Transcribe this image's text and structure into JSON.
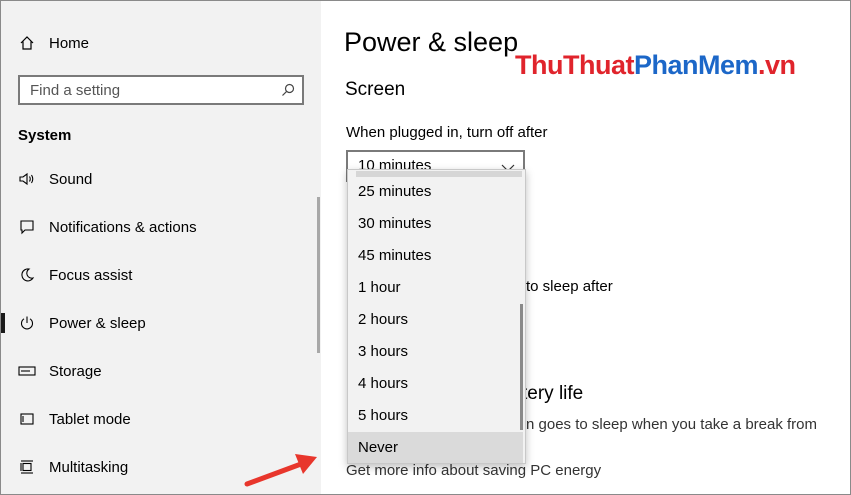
{
  "sidebar": {
    "home_label": "Home",
    "search_placeholder": "Find a setting",
    "section_title": "System",
    "items": [
      {
        "label": "Sound",
        "icon": "speaker-icon"
      },
      {
        "label": "Notifications & actions",
        "icon": "notification-icon"
      },
      {
        "label": "Focus assist",
        "icon": "moon-icon"
      },
      {
        "label": "Power & sleep",
        "icon": "power-icon"
      },
      {
        "label": "Storage",
        "icon": "storage-icon"
      },
      {
        "label": "Tablet mode",
        "icon": "tablet-icon"
      },
      {
        "label": "Multitasking",
        "icon": "multitasking-icon"
      }
    ]
  },
  "main": {
    "title": "Power & sleep",
    "watermark": {
      "part1": "ThuThuat",
      "part2": "PhanMem",
      "part3": ".vn"
    },
    "screen_heading": "Screen",
    "plugged_label": "When plugged in, turn off after",
    "plugged_value": "10 minutes",
    "sleep_label_partial": "to sleep after",
    "battery_heading_partial": "tery life",
    "battery_text_partial": "n goes to sleep when you take a break from",
    "link_partial": "Get more info about saving PC energy"
  },
  "dropdown": {
    "options": [
      "25 minutes",
      "30 minutes",
      "45 minutes",
      "1 hour",
      "2 hours",
      "3 hours",
      "4 hours",
      "5 hours",
      "Never"
    ],
    "hovered": "Never"
  },
  "colors": {
    "sidebar_bg": "#f2f2f2",
    "watermark_red": "#e0242c",
    "watermark_blue": "#1c67c8",
    "arrow": "#e8362c"
  }
}
